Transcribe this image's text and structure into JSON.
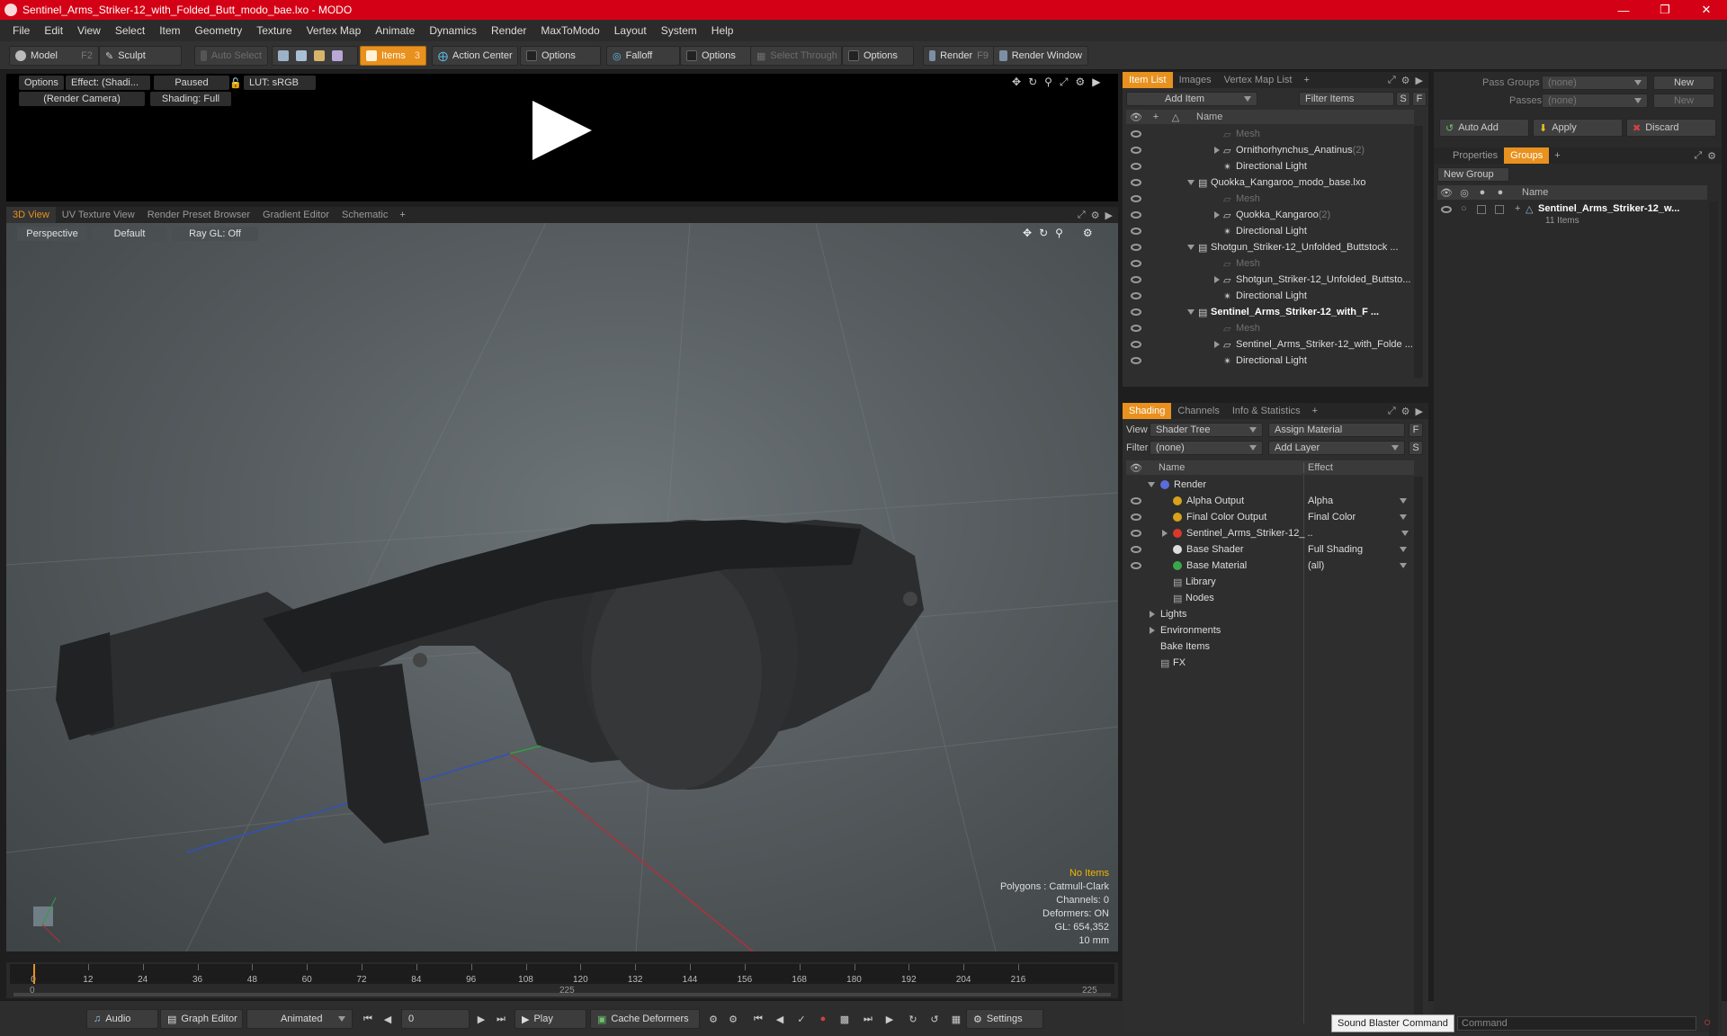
{
  "window": {
    "title": "Sentinel_Arms_Striker-12_with_Folded_Butt_modo_bae.lxo - MODO"
  },
  "menu": [
    "File",
    "Edit",
    "View",
    "Select",
    "Item",
    "Geometry",
    "Texture",
    "Vertex Map",
    "Animate",
    "Dynamics",
    "Render",
    "MaxToModo",
    "Layout",
    "System",
    "Help"
  ],
  "toolbar": {
    "model": "Model",
    "model_key": "F2",
    "sculpt": "Sculpt",
    "auto_select": "Auto Select",
    "items": "Items",
    "items_key": "3",
    "action_center": "Action Center",
    "options1": "Options",
    "falloff": "Falloff",
    "options2": "Options",
    "select_through": "Select Through",
    "options3": "Options",
    "render": "Render",
    "render_key": "F9",
    "render_window": "Render Window"
  },
  "preview": {
    "options": "Options",
    "effect": "Effect: (Shadi...",
    "paused": "Paused",
    "lut": "LUT: sRGB",
    "camera": "(Render Camera)",
    "shading": "Shading: Full"
  },
  "viewport_tabs": [
    "3D View",
    "UV Texture View",
    "Render Preset Browser",
    "Gradient Editor",
    "Schematic"
  ],
  "viewport": {
    "perspective": "Perspective",
    "default": "Default",
    "raygl": "Ray GL: Off",
    "info": {
      "no_items": "No Items",
      "polygons": "Polygons : Catmull-Clark",
      "channels": "Channels: 0",
      "deformers": "Deformers: ON",
      "gl": "GL: 654,352",
      "scale": "10 mm"
    }
  },
  "timeline": {
    "ticks": [
      "0",
      "12",
      "24",
      "36",
      "48",
      "60",
      "72",
      "84",
      "96",
      "108",
      "120",
      "132",
      "144",
      "156",
      "168",
      "180",
      "192",
      "204",
      "216"
    ],
    "start": "0",
    "mid": "225",
    "end": "225"
  },
  "transport": {
    "audio": "Audio",
    "graph_editor": "Graph Editor",
    "animated": "Animated",
    "frame": "0",
    "play": "Play",
    "cache_deformers": "Cache Deformers",
    "settings": "Settings"
  },
  "item_list": {
    "tabs": [
      "Item List",
      "Images",
      "Vertex Map List"
    ],
    "add_item": "Add Item",
    "filter": "Filter Items",
    "s": "S",
    "f": "F",
    "col_name": "Name",
    "rows": [
      {
        "label": "Mesh",
        "dim": true,
        "indent": 3
      },
      {
        "label": "Ornithorhynchus_Anatinus",
        "count": "(2)",
        "indent": 3,
        "expander": true
      },
      {
        "label": "Directional Light",
        "indent": 3
      },
      {
        "label": "Quokka_Kangaroo_modo_base.lxo",
        "indent": 1,
        "expander": true,
        "open": true
      },
      {
        "label": "Mesh",
        "dim": true,
        "indent": 3
      },
      {
        "label": "Quokka_Kangaroo",
        "count": "(2)",
        "indent": 3,
        "expander": true
      },
      {
        "label": "Directional Light",
        "indent": 3
      },
      {
        "label": "Shotgun_Striker-12_Unfolded_Buttstock ...",
        "indent": 1,
        "expander": true,
        "open": true
      },
      {
        "label": "Mesh",
        "dim": true,
        "indent": 3
      },
      {
        "label": "Shotgun_Striker-12_Unfolded_Buttsto...",
        "indent": 3,
        "expander": true
      },
      {
        "label": "Directional Light",
        "indent": 3
      },
      {
        "label": "Sentinel_Arms_Striker-12_with_F ...",
        "indent": 1,
        "expander": true,
        "open": true,
        "bold": true
      },
      {
        "label": "Mesh",
        "dim": true,
        "indent": 3
      },
      {
        "label": "Sentinel_Arms_Striker-12_with_Folde ...",
        "indent": 3,
        "expander": true
      },
      {
        "label": "Directional Light",
        "indent": 3
      }
    ]
  },
  "shading": {
    "tabs": [
      "Shading",
      "Channels",
      "Info & Statistics"
    ],
    "view_label": "View",
    "view_value": "Shader Tree",
    "assign_material": "Assign Material",
    "f": "F",
    "filter_label": "Filter",
    "filter_value": "(none)",
    "add_layer": "Add Layer",
    "s": "S",
    "col_name": "Name",
    "col_effect": "Effect",
    "rows": [
      {
        "label": "Render",
        "effect": "",
        "indent": 0,
        "eye": false,
        "color": "#5a6cd8"
      },
      {
        "label": "Alpha Output",
        "effect": "Alpha",
        "indent": 1,
        "eye": true,
        "color": "#d8a21a"
      },
      {
        "label": "Final Color Output",
        "effect": "Final Color",
        "indent": 1,
        "eye": true,
        "color": "#d8a21a"
      },
      {
        "label": "Sentinel_Arms_Striker-12_ ...",
        "effect": "",
        "indent": 1,
        "eye": true,
        "color": "#d83a2a"
      },
      {
        "label": "Base Shader",
        "effect": "Full Shading",
        "indent": 1,
        "eye": true,
        "color": "#dddddd"
      },
      {
        "label": "Base Material",
        "effect": "(all)",
        "indent": 1,
        "eye": true,
        "color": "#3aa84a"
      },
      {
        "label": "Library",
        "effect": "",
        "indent": 1,
        "eye": false,
        "color": ""
      },
      {
        "label": "Nodes",
        "effect": "",
        "indent": 1,
        "eye": false,
        "color": ""
      },
      {
        "label": "Lights",
        "effect": "",
        "indent": 0,
        "eye": false,
        "color": ""
      },
      {
        "label": "Environments",
        "effect": "",
        "indent": 0,
        "eye": false,
        "color": ""
      },
      {
        "label": "Bake Items",
        "effect": "",
        "indent": 0,
        "eye": false,
        "color": ""
      },
      {
        "label": "FX",
        "effect": "",
        "indent": 0,
        "eye": false,
        "color": ""
      }
    ]
  },
  "groups_panel": {
    "pass_groups_label": "Pass Groups",
    "pass_groups_value": "(none)",
    "new": "New",
    "passes_label": "Passes",
    "passes_value": "(none)",
    "new2": "New",
    "auto_add": "Auto Add",
    "apply": "Apply",
    "discard": "Discard",
    "tabs": [
      "Properties",
      "Groups"
    ],
    "new_group": "New Group",
    "col_name": "Name",
    "group_name": "Sentinel_Arms_Striker-12_w...",
    "group_count": "11 Items"
  },
  "tooltip": "Sound Blaster Command",
  "command_placeholder": "Command",
  "colors": {
    "accent": "#e8911e",
    "titlebar": "#d40015"
  }
}
